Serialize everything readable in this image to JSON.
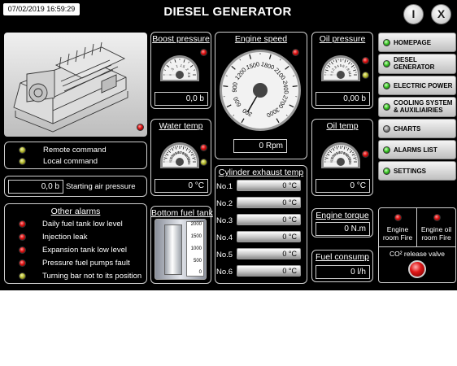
{
  "header": {
    "datetime": "07/02/2019 16:59:29",
    "title": "DIESEL GENERATOR",
    "info_button": "I",
    "close_button": "X"
  },
  "commands": {
    "remote": "Remote command",
    "local": "Local command"
  },
  "starting_air": {
    "value": "0,0 b",
    "label": "Starting air pressure"
  },
  "other_alarms": {
    "title": "Other alarms",
    "items": [
      {
        "label": "Daily fuel tank low level",
        "led": "red"
      },
      {
        "label": "Injection leak",
        "led": "red"
      },
      {
        "label": "Expansion tank low level",
        "led": "red"
      },
      {
        "label": "Pressure fuel pumps fault",
        "led": "red"
      },
      {
        "label": "Turning bar not to its position",
        "led": "yellow"
      }
    ]
  },
  "boost_pressure": {
    "title": "Boost pressure",
    "value": "0,0 b",
    "ticks": [
      "0",
      ".5",
      "1",
      "1.5",
      "2",
      "2.5"
    ],
    "level": 0
  },
  "water_temp": {
    "title": "Water temp",
    "value": "0 °C",
    "ticks": [
      "0",
      "10",
      "20",
      "30",
      "40",
      "50",
      "60",
      "70",
      "80",
      "90",
      "100",
      "110",
      "120"
    ],
    "level": 0
  },
  "bottom_fuel_tank": {
    "title": "Bottom fuel tank",
    "scale": [
      "2000",
      "1500",
      "1000",
      "500",
      "0"
    ],
    "level": 0
  },
  "engine_speed": {
    "title": "Engine speed",
    "value": "0 Rpm",
    "ticks": [
      "300",
      "600",
      "900",
      "1200",
      "1500",
      "1800",
      "2100",
      "2400",
      "2700",
      "3000"
    ],
    "level": 0
  },
  "cylinder_exhaust": {
    "title": "Cylinder exhaust temp",
    "rows": [
      {
        "label": "No.1",
        "value": "0 °C"
      },
      {
        "label": "No.2",
        "value": "0 °C"
      },
      {
        "label": "No.3",
        "value": "0 °C"
      },
      {
        "label": "No.4",
        "value": "0 °C"
      },
      {
        "label": "No.5",
        "value": "0 °C"
      },
      {
        "label": "No.6",
        "value": "0 °C"
      }
    ]
  },
  "oil_pressure": {
    "title": "Oil pressure",
    "value": "0,00 b",
    "ticks": [
      "0",
      "1",
      "2",
      "3",
      "4",
      "5",
      "6",
      "7",
      "8",
      "9",
      "10"
    ],
    "level": 0
  },
  "oil_temp": {
    "title": "Oil temp",
    "value": "0 °C",
    "ticks": [
      "0",
      "10",
      "20",
      "30",
      "40",
      "50",
      "60",
      "70",
      "80",
      "90",
      "100",
      "110",
      "120"
    ],
    "level": 0
  },
  "engine_torque": {
    "title": "Engine torque",
    "value": "0 N.m"
  },
  "fuel_consump": {
    "title": "Fuel consump",
    "value": "0 l/h"
  },
  "nav": [
    {
      "label": "HOMEPAGE",
      "led": "green"
    },
    {
      "label": "DIESEL\nGENERATOR",
      "led": "green"
    },
    {
      "label": "ELECTRIC POWER",
      "led": "green"
    },
    {
      "label": "COOLING SYSTEM\n& AUXILIAIRIES",
      "led": "green"
    },
    {
      "label": "CHARTS",
      "led": "grey"
    },
    {
      "label": "ALARMS LIST",
      "led": "green"
    },
    {
      "label": "SETTINGS",
      "led": "green"
    }
  ],
  "fire": {
    "engine_room": "Engine\nroom Fire",
    "engine_oil_room": "Engine oil\nroom Fire",
    "co2_label": "CO² release valve"
  },
  "colors": {
    "alarm_red": "#dd1111",
    "led_green": "#3cc828",
    "led_yellow": "#b6bb30",
    "screen_bg": "#000000"
  }
}
